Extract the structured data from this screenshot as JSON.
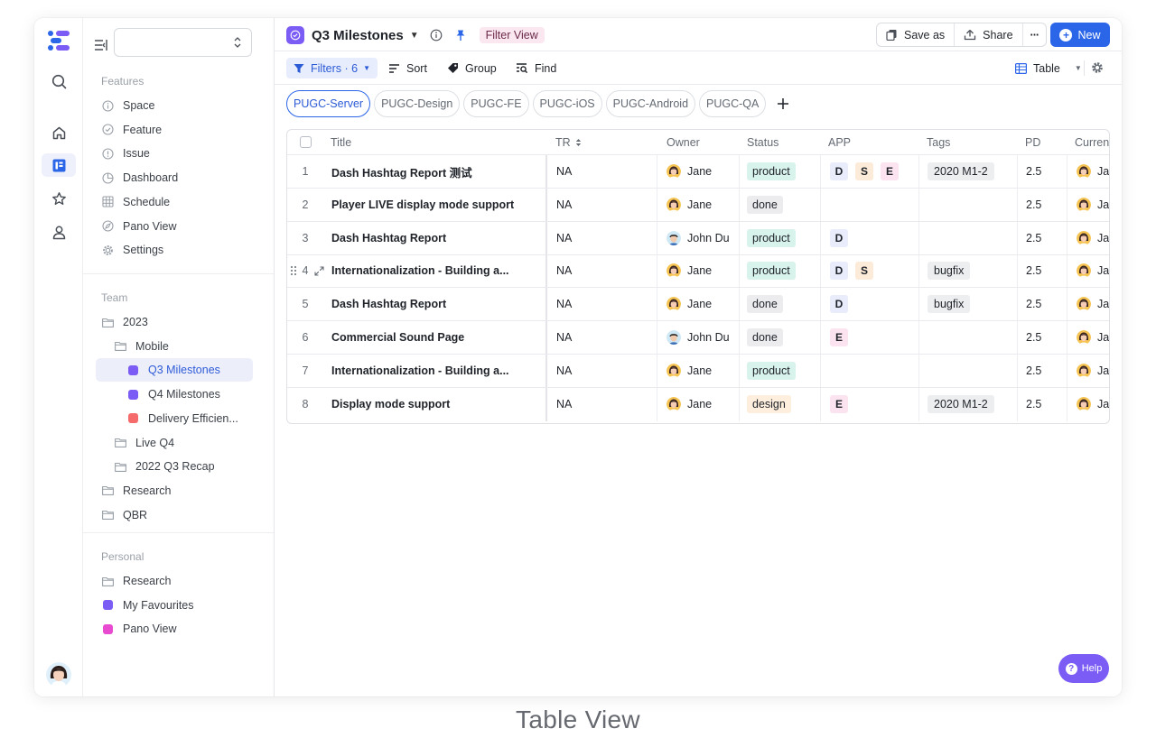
{
  "sidebar": {
    "features_title": "Features",
    "features": [
      {
        "label": "Space",
        "icon": "info-circle-icon"
      },
      {
        "label": "Feature",
        "icon": "check-circle-icon"
      },
      {
        "label": "Issue",
        "icon": "alert-circle-icon"
      },
      {
        "label": "Dashboard",
        "icon": "pie-chart-icon"
      },
      {
        "label": "Schedule",
        "icon": "calendar-grid-icon"
      },
      {
        "label": "Pano View",
        "icon": "compass-icon"
      },
      {
        "label": "Settings",
        "icon": "gear-icon"
      }
    ],
    "team_title": "Team",
    "team": [
      {
        "label": "2023",
        "kind": "folder"
      },
      {
        "label": "Mobile",
        "kind": "folder"
      },
      {
        "label": "Q3 Milestones",
        "kind": "view",
        "color": "#7b5cf5",
        "active": true
      },
      {
        "label": "Q4 Milestones",
        "kind": "view",
        "color": "#7b5cf5"
      },
      {
        "label": "Delivery Efficien...",
        "kind": "view",
        "color": "#f56b6b"
      },
      {
        "label": "Live Q4",
        "kind": "folder"
      },
      {
        "label": "2022 Q3 Recap",
        "kind": "folder"
      },
      {
        "label": "Research",
        "kind": "folder"
      },
      {
        "label": "QBR",
        "kind": "folder"
      }
    ],
    "personal_title": "Personal",
    "personal": [
      {
        "label": "Research",
        "kind": "folder"
      },
      {
        "label": "My Favourites",
        "kind": "view",
        "color": "#7b5cf5"
      },
      {
        "label": "Pano View",
        "kind": "view",
        "color": "#e84bd0"
      }
    ]
  },
  "topbar": {
    "title": "Q3 Milestones",
    "filter_view": "Filter View",
    "save_as": "Save as",
    "share": "Share",
    "more": "···",
    "new": "New"
  },
  "toolbar": {
    "filters": "Filters · 6",
    "sort": "Sort",
    "group": "Group",
    "find": "Find",
    "view_type": "Table"
  },
  "tabs": [
    "PUGC-Server",
    "PUGC-Design",
    "PUGC-FE",
    "PUGC-iOS",
    "PUGC-Android",
    "PUGC-QA"
  ],
  "table": {
    "columns": {
      "title": "Title",
      "tr": "TR",
      "owner": "Owner",
      "status": "Status",
      "app": "APP",
      "tags": "Tags",
      "pd": "PD",
      "current": "Curren"
    },
    "rows": [
      {
        "n": "1",
        "title": "Dash Hashtag Report 测试",
        "tr": "NA",
        "owner": "Jane",
        "status": "product",
        "app": [
          "D",
          "S",
          "E"
        ],
        "tags": "2020 M1-2",
        "pd": "2.5",
        "current": "Jan"
      },
      {
        "n": "2",
        "title": "Player LIVE display mode support",
        "tr": "NA",
        "owner": "Jane",
        "status": "done",
        "app": [],
        "tags": "",
        "pd": "2.5",
        "current": "Jan"
      },
      {
        "n": "3",
        "title": "Dash Hashtag Report",
        "tr": "NA",
        "owner": "John Du",
        "status": "product",
        "app": [
          "D"
        ],
        "tags": "",
        "pd": "2.5",
        "current": "Jan"
      },
      {
        "n": "4",
        "title": "Internationalization - Building a...",
        "tr": "NA",
        "owner": "Jane",
        "status": "product",
        "app": [
          "D",
          "S"
        ],
        "tags": "bugfix",
        "pd": "2.5",
        "current": "Jan"
      },
      {
        "n": "5",
        "title": "Dash Hashtag Report",
        "tr": "NA",
        "owner": "Jane",
        "status": "done",
        "app": [
          "D"
        ],
        "tags": "bugfix",
        "pd": "2.5",
        "current": "Jan"
      },
      {
        "n": "6",
        "title": "Commercial Sound Page",
        "tr": "NA",
        "owner": "John Du",
        "status": "done",
        "app": [
          "E"
        ],
        "tags": "",
        "pd": "2.5",
        "current": "Jan"
      },
      {
        "n": "7",
        "title": "Internationalization - Building a...",
        "tr": "NA",
        "owner": "Jane",
        "status": "product",
        "app": [],
        "tags": "",
        "pd": "2.5",
        "current": "Jan"
      },
      {
        "n": "8",
        "title": "Display mode support",
        "tr": "NA",
        "owner": "Jane",
        "status": "design",
        "app": [
          "E"
        ],
        "tags": "2020 M1-2",
        "pd": "2.5",
        "current": "Jan"
      }
    ]
  },
  "help": "Help",
  "caption": "Table View",
  "colors": {
    "accent": "#2c66e8",
    "brand_purple": "#7b5cf5"
  }
}
